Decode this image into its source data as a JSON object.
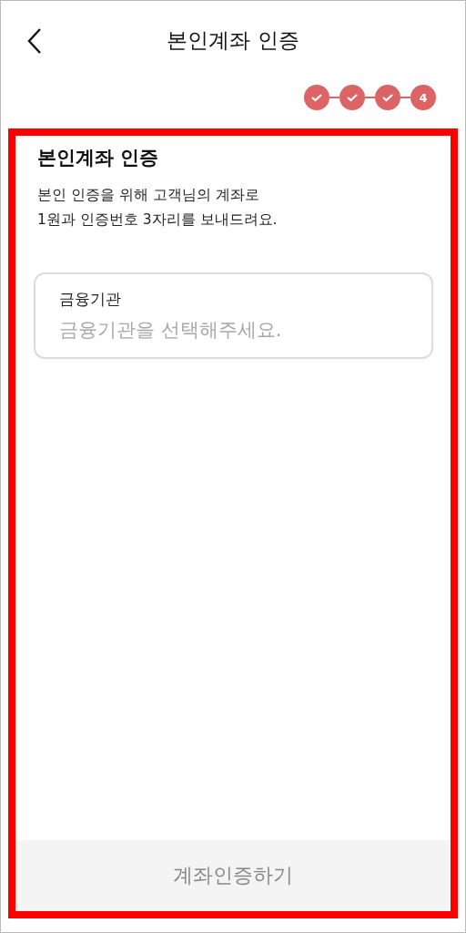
{
  "header": {
    "title": "본인계좌 인증"
  },
  "steps": [
    {
      "done": true
    },
    {
      "done": true
    },
    {
      "done": true
    },
    {
      "label": "4",
      "done": false
    }
  ],
  "section": {
    "title": "본인계좌 인증",
    "description": "본인 인증을 위해 고객님의 계좌로\n1원과 인증번호 3자리를 보내드려요."
  },
  "field": {
    "label": "금융기관",
    "placeholder": "금융기관을 선택해주세요."
  },
  "submit": {
    "label": "계좌인증하기",
    "disabled": true
  }
}
